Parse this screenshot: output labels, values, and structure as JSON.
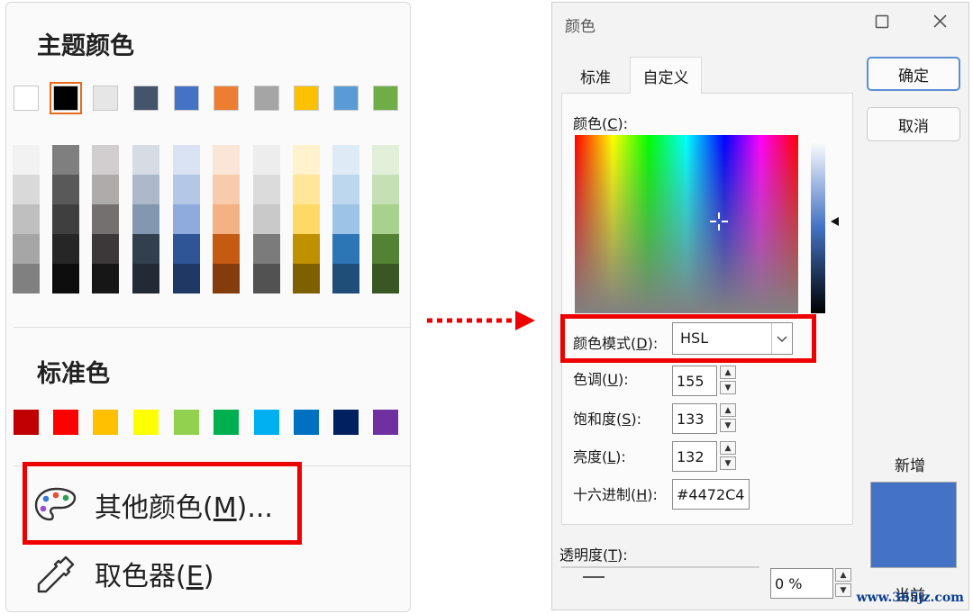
{
  "menu": {
    "theme_heading": "主题颜色",
    "theme_colors": [
      "#ffffff",
      "#000000",
      "#e7e6e6",
      "#44546a",
      "#4472c4",
      "#ed7d31",
      "#a5a5a5",
      "#ffc000",
      "#5b9bd5",
      "#70ad47"
    ],
    "theme_shades": [
      [
        "#f2f2f2",
        "#d9d9d9",
        "#bfbfbf",
        "#a6a6a6",
        "#808080"
      ],
      [
        "#7f7f7f",
        "#595959",
        "#3f3f3f",
        "#262626",
        "#0d0d0d"
      ],
      [
        "#d0cece",
        "#aeabab",
        "#757070",
        "#3a3838",
        "#171616"
      ],
      [
        "#d6dce4",
        "#adb9ca",
        "#8497b0",
        "#323f4f",
        "#222a35"
      ],
      [
        "#dae3f3",
        "#b4c7e7",
        "#8faadc",
        "#2f5597",
        "#203864"
      ],
      [
        "#fbe5d6",
        "#f8cbad",
        "#f4b183",
        "#c55a11",
        "#843c0c"
      ],
      [
        "#ededed",
        "#dbdbdb",
        "#c9c9c9",
        "#7b7b7b",
        "#525252"
      ],
      [
        "#fff2cc",
        "#ffe699",
        "#ffd966",
        "#bf9000",
        "#7f6000"
      ],
      [
        "#deebf7",
        "#bdd7ee",
        "#9dc3e6",
        "#2e75b6",
        "#1f4e79"
      ],
      [
        "#e2f0d9",
        "#c5e0b4",
        "#a9d18e",
        "#548235",
        "#385723"
      ]
    ],
    "standard_heading": "标准色",
    "standard_colors": [
      "#c00000",
      "#ff0000",
      "#ffc000",
      "#ffff00",
      "#92d050",
      "#00b050",
      "#00b0f0",
      "#0070c0",
      "#002060",
      "#7030a0"
    ],
    "more_colors_text": "其他颜色(",
    "more_colors_key": "M",
    "more_colors_suffix": ")...",
    "eyedropper_text": "取色器(",
    "eyedropper_key": "E",
    "eyedropper_suffix": ")",
    "palette_icon": "palette-icon",
    "eyedropper_icon": "eyedropper-icon"
  },
  "dialog": {
    "title": "颜色",
    "tabs": [
      "标准",
      "自定义"
    ],
    "active_tab": "自定义",
    "colors_label": "颜色(",
    "colors_key": "C",
    "colors_suffix": "):",
    "mode_label": "颜色模式(",
    "mode_key": "D",
    "mode_suffix": "):",
    "mode_value": "HSL",
    "hue_label": "色调(",
    "hue_key": "U",
    "hue_suffix": "):",
    "hue_value": "155",
    "sat_label": "饱和度(",
    "sat_key": "S",
    "sat_suffix": "):",
    "sat_value": "133",
    "lum_label": "亮度(",
    "lum_key": "L",
    "lum_suffix": "):",
    "lum_value": "132",
    "hex_label": "十六进制(",
    "hex_key": "H",
    "hex_suffix": "):",
    "hex_value": "#4472C4",
    "transparency_label": "透明度(",
    "transparency_key": "T",
    "transparency_suffix": "):",
    "transparency_value": "0 %",
    "ok_label": "确定",
    "cancel_label": "取消",
    "new_label": "新增",
    "current_label": "当前",
    "new_color": "#4472c4"
  },
  "watermark": "www.365jz.com",
  "accent_red": "#ee0000"
}
